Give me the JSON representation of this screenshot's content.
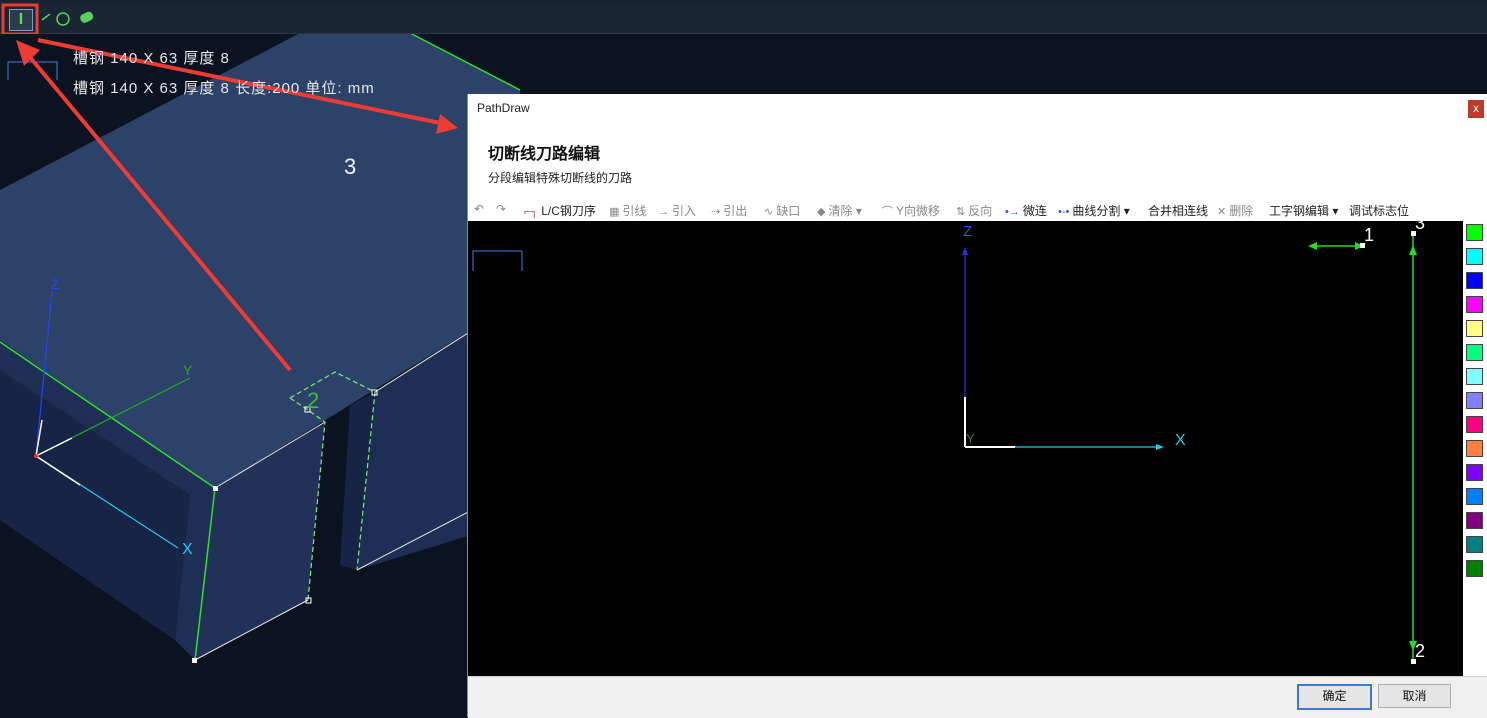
{
  "toolbar": {
    "ibeam_glyph": "I"
  },
  "scene": {
    "info_line1": "槽钢 140 X 63 厚度 8",
    "info_line2": "槽钢 140 X 63 厚度 8 长度:200 单位: mm",
    "number_3": "3",
    "label_2": "2",
    "axis_z": "Z",
    "axis_y": "Y",
    "axis_x": "X"
  },
  "dialog": {
    "title": "PathDraw",
    "close": "x",
    "heading": "切断线刀路编辑",
    "subtitle": "分段编辑特殊切断线的刀路",
    "tools": {
      "lc_order": "L/C钢刀序",
      "lead_line": "引线",
      "lead_in": "引入",
      "lead_out": "引出",
      "notch": "缺口",
      "clear": "清除",
      "y_shift": "Y向微移",
      "reverse": "反向",
      "micro_join": "微连",
      "curve_split": "曲线分割",
      "merge_connect": "合并相连线",
      "delete": "删除",
      "ibeam_edit": "工字钢编辑",
      "debug_flag": "调试标志位"
    },
    "canvas": {
      "axis_z": "Z",
      "axis_x": "X",
      "axis_y": "Y",
      "point_1": "1",
      "point_2": "2",
      "point_3": "3"
    },
    "palette": [
      "#00ff00",
      "#00ffff",
      "#0000ff",
      "#ff00ff",
      "#ffff80",
      "#00ff80",
      "#80ffff",
      "#8080ff",
      "#ff0080",
      "#ff8040",
      "#8000ff",
      "#0080ff",
      "#800080",
      "#008080",
      "#008000"
    ],
    "ok": "确定",
    "cancel": "取消"
  },
  "colors": {
    "annotation_red": "#ee3b33",
    "path_green": "#22dd22",
    "beam_blue": "#2b3d63"
  }
}
